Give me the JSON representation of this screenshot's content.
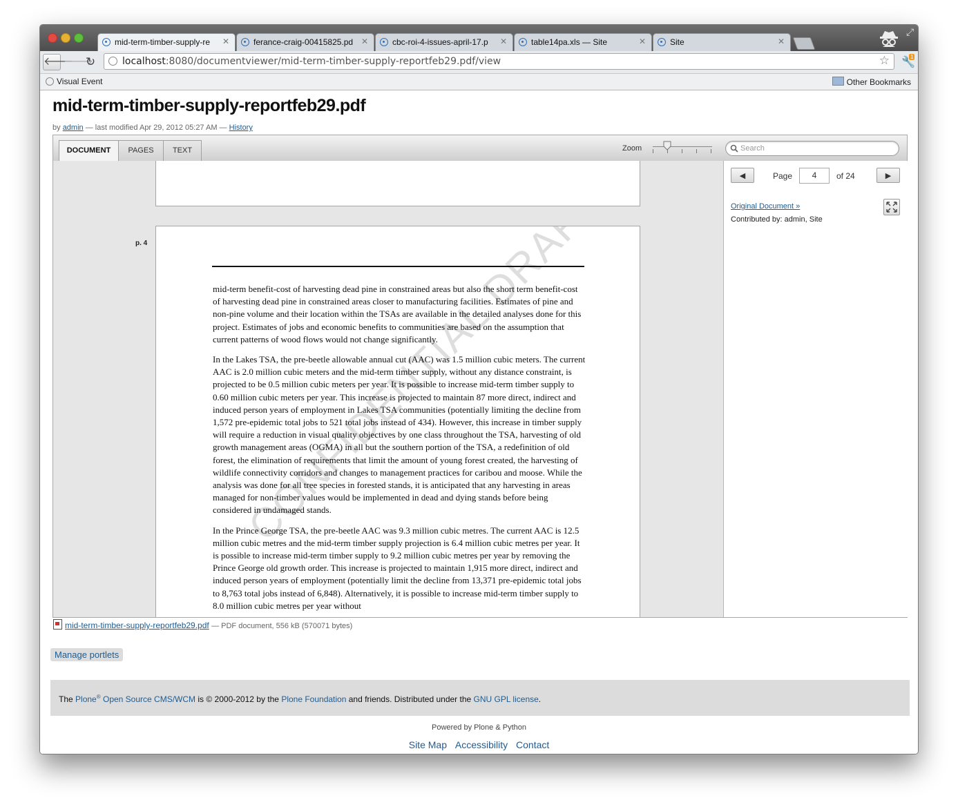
{
  "browser": {
    "tabs": [
      {
        "label": "mid-term-timber-supply-re"
      },
      {
        "label": "ferance-craig-00415825.pd"
      },
      {
        "label": "cbc-roi-4-issues-april-17.p"
      },
      {
        "label": "table14pa.xls — Site"
      },
      {
        "label": "Site"
      }
    ],
    "url_host": "localhost",
    "url_rest": ":8080/documentviewer/mid-term-timber-supply-reportfeb29.pdf/view",
    "bookmark": "Visual Event",
    "other_bookmarks": "Other Bookmarks",
    "ext_badge": "1"
  },
  "page": {
    "title": "mid-term-timber-supply-reportfeb29.pdf",
    "by": "by",
    "author": "admin",
    "modified": "— last modified Apr 29, 2012 05:27 AM —",
    "history": "History"
  },
  "viewer": {
    "tabs": [
      "DOCUMENT",
      "PAGES",
      "TEXT"
    ],
    "zoom_label": "Zoom",
    "search_placeholder": "Search",
    "page_label": "Page",
    "page_current": "4",
    "page_total": "of 24",
    "page_marker": "p. 4",
    "original_link": "Original Document »",
    "contributed": "Contributed by: admin, Site",
    "watermark": "CONFIDENTIAL DRAFT",
    "paragraphs": [
      "mid-term benefit-cost of harvesting dead pine in constrained areas but also the short term benefit-cost of harvesting dead pine in constrained areas closer to manufacturing facilities. Estimates of pine and non-pine volume and their location within the TSAs are available in the detailed analyses done for this project.  Estimates of jobs and economic benefits to communities are based on the assumption that current patterns of wood flows would not change significantly.",
      "In the Lakes TSA, the pre-beetle allowable annual cut (AAC) was 1.5 million cubic meters.  The current AAC is 2.0 million cubic meters and the mid-term timber supply, without any distance constraint, is projected to be 0.5 million cubic meters per year. It is possible to increase mid-term timber supply to 0.60 million cubic meters per year.  This increase is projected to maintain 87 more direct, indirect and induced person years of employment in Lakes TSA communities (potentially limiting the decline from 1,572 pre-epidemic total jobs to 521 total jobs instead of 434).  However, this increase in timber supply will require a reduction in visual quality objectives by one class throughout the TSA, harvesting of old growth management areas (OGMA) in all but the southern portion of the TSA, a redefinition of old forest, the elimination of requirements that limit the amount of young forest created, the harvesting of wildlife connectivity corridors and changes to management practices for caribou and moose.  While the analysis was done for all tree species in forested stands, it is anticipated that any harvesting in areas managed for non-timber values would be implemented in dead and dying stands before being considered in undamaged stands.",
      "In the Prince George TSA, the pre-beetle AAC was 9.3 million cubic metres.  The current AAC is 12.5 million cubic metres and the mid-term timber supply projection is 6.4 million cubic metres per year.  It is possible to increase mid-term timber supply to 9.2 million cubic metres per year by removing the Prince George old growth order.  This increase is projected to maintain 1,915 more direct, indirect and induced person years of employment (potentially limit the decline from 13,371 pre-epidemic total jobs to 8,763 total jobs instead of 6,848).   Alternatively, it is possible to increase mid-term timber supply to 8.0 million cubic metres per year without"
    ]
  },
  "file": {
    "name": "mid-term-timber-supply-reportfeb29.pdf",
    "meta": "— PDF document, 556 kB (570071 bytes)"
  },
  "manage_portlets": "Manage portlets",
  "footer": {
    "the": "The",
    "plone": "Plone",
    "reg": "®",
    "cms": "Open Source CMS/WCM",
    "copy": "is © 2000-2012 by the",
    "foundation": "Plone Foundation",
    "friends": "and friends. Distributed under the",
    "license": "GNU GPL license",
    "period": ".",
    "powered": "Powered by Plone & Python",
    "links": [
      "Site Map",
      "Accessibility",
      "Contact"
    ]
  }
}
